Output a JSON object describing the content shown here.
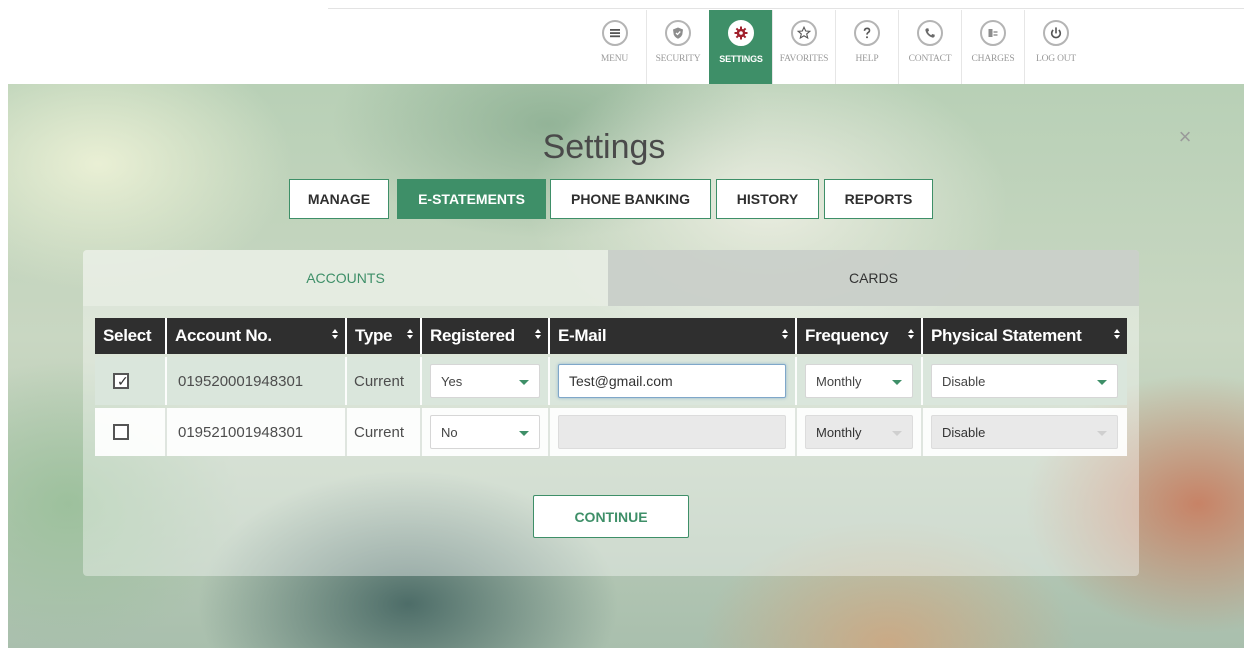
{
  "nav": {
    "items": [
      {
        "label": "MENU",
        "icon": "menu-icon"
      },
      {
        "label": "SECURITY",
        "icon": "shield-icon"
      },
      {
        "label": "SETTINGS",
        "icon": "gear-icon",
        "active": true
      },
      {
        "label": "FAVORITES",
        "icon": "star-icon"
      },
      {
        "label": "HELP",
        "icon": "question-icon"
      },
      {
        "label": "CONTACT",
        "icon": "phone-icon"
      },
      {
        "label": "CHARGES",
        "icon": "charges-icon"
      },
      {
        "label": "LOG OUT",
        "icon": "power-icon"
      }
    ]
  },
  "page": {
    "title": "Settings",
    "close_symbol": "×"
  },
  "tabs": [
    {
      "label": "MANAGE"
    },
    {
      "label": "E-STATEMENTS",
      "active": true
    },
    {
      "label": "PHONE BANKING"
    },
    {
      "label": "HISTORY"
    },
    {
      "label": "REPORTS"
    }
  ],
  "subtabs": [
    {
      "label": "ACCOUNTS",
      "active": true
    },
    {
      "label": "CARDS"
    }
  ],
  "table": {
    "headers": [
      "Select",
      "Account No.",
      "Type",
      "Registered",
      "E-Mail",
      "Frequency",
      "Physical Statement"
    ],
    "rows": [
      {
        "selected": true,
        "account_no": "019520001948301",
        "type": "Current",
        "registered": "Yes",
        "email": "Test@gmail.com",
        "frequency": "Monthly",
        "physical_statement": "Disable"
      },
      {
        "selected": false,
        "account_no": "019521001948301",
        "type": "Current",
        "registered": "No",
        "email": "",
        "frequency": "Monthly",
        "physical_statement": "Disable"
      }
    ]
  },
  "continue_label": "CONTINUE",
  "colors": {
    "accent": "#3e8f68",
    "header_bg": "#2f2f2f",
    "selected_row": "#dae6dc",
    "field_focus_border": "#7fa7c9"
  }
}
